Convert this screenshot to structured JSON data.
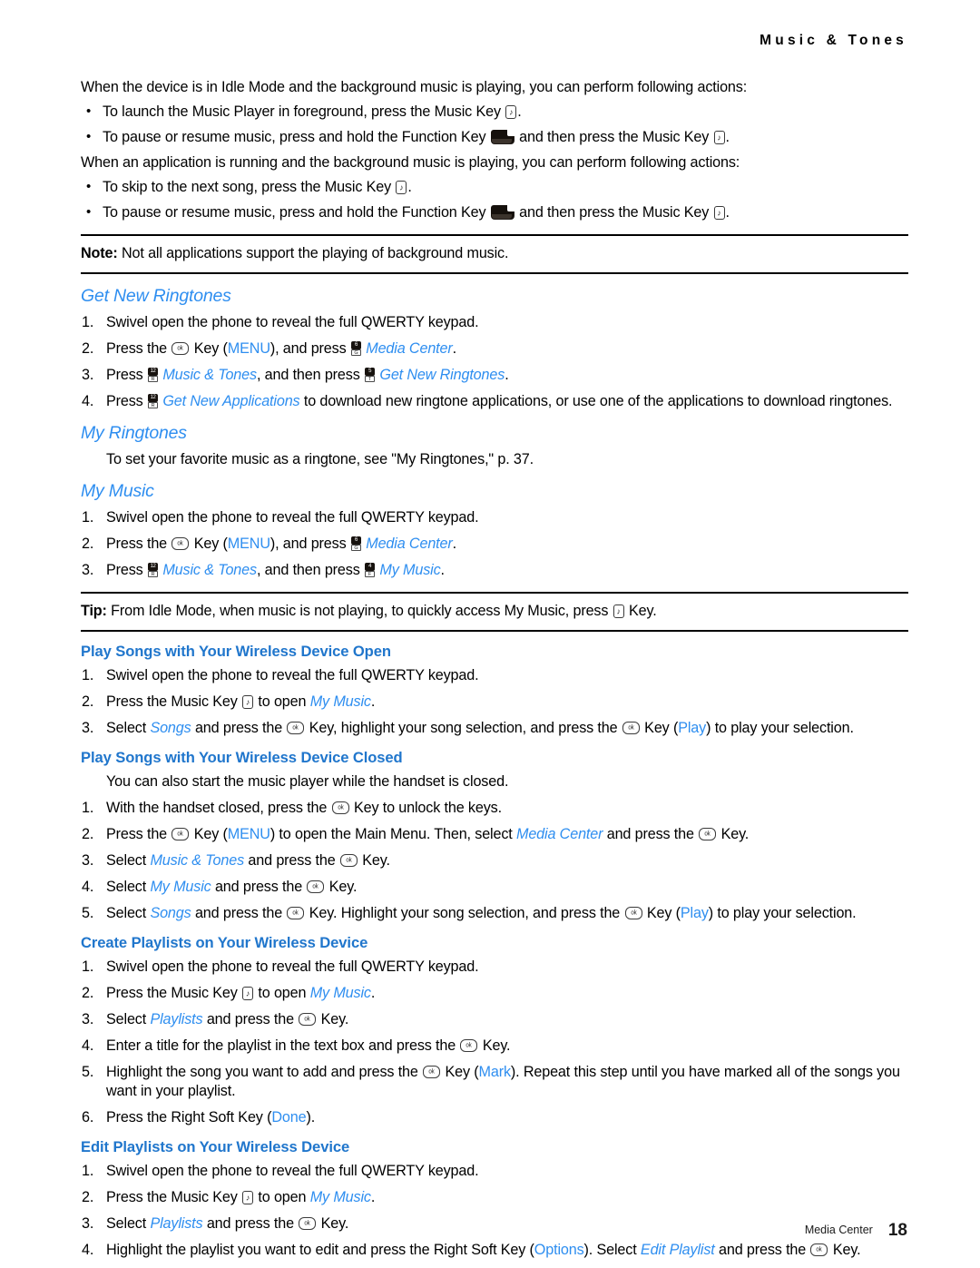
{
  "header": {
    "running_head": "Music & Tones"
  },
  "intro": {
    "para1": "When the device is in Idle Mode and the background music is playing, you can perform following actions:",
    "bullets1": [
      {
        "before": "To launch the Music Player in foreground, press the Music Key ",
        "icon": "music-key-icon",
        "after": "."
      },
      {
        "before": "To pause or resume music, press and hold the Function Key ",
        "icon": "function-key-icon",
        "mid": " and then press the Music Key ",
        "icon2": "music-key-icon",
        "after": "."
      }
    ],
    "para2": "When an application is running and the background music is playing, you can perform following actions:",
    "bullets2": [
      {
        "before": "To skip to the next song, press the Music Key ",
        "icon": "music-key-icon",
        "after": "."
      },
      {
        "before": "To pause or resume music, press and hold the Function Key ",
        "icon": "function-key-icon",
        "mid": " and then press the Music Key ",
        "icon2": "music-key-icon",
        "after": "."
      }
    ]
  },
  "note": {
    "label": "Note:",
    "text": "Not all applications support the playing of background music."
  },
  "get_new_ringtones": {
    "heading": "Get New Ringtones",
    "step1": "Swivel open the phone to reveal the full QWERTY keypad.",
    "step2": {
      "a": "Press the ",
      "b": "Key (",
      "menu": "MENU",
      "c": "), and press ",
      "link": "Media Center",
      "d": "."
    },
    "step3": {
      "a": "Press ",
      "link1": "Music & Tones",
      "b": ", and then press ",
      "link2": "Get New Ringtones",
      "c": "."
    },
    "step4": {
      "a": "Press ",
      "link": "Get New Applications",
      "b": " to download new ringtone applications, or use one of the applications to download ringtones."
    },
    "keys": {
      "step2_key": "ok-key-icon",
      "step2_letter": {
        "num": "6",
        "ltr": "G"
      },
      "step3_letter1": {
        "num": "12",
        "ltr": "R"
      },
      "step3_letter2": {
        "num": "5",
        "ltr": "T"
      },
      "step4_letter": {
        "num": "12",
        "ltr": "R"
      }
    }
  },
  "my_ringtones": {
    "heading": "My Ringtones",
    "body": "To set your favorite music as a ringtone, see \"My Ringtones,\" p. 37."
  },
  "my_music": {
    "heading": "My Music",
    "step1": "Swivel open the phone to reveal the full QWERTY keypad.",
    "step2": {
      "a": "Press the ",
      "b": "Key (",
      "menu": "MENU",
      "c": "), and press ",
      "link": "Media Center",
      "d": "."
    },
    "step3": {
      "a": "Press ",
      "link1": "Music & Tones",
      "b": ", and then press ",
      "link2": "My Music",
      "c": "."
    },
    "keys": {
      "step2_letter": {
        "num": "6",
        "ltr": "G"
      },
      "step3_letter1": {
        "num": "12",
        "ltr": "R"
      },
      "step3_letter2": {
        "num": "4",
        "ltr": "F"
      }
    }
  },
  "tip": {
    "label": "Tip:",
    "before": "From Idle Mode, when music is not playing, to quickly access My Music, press ",
    "icon": "music-key-icon",
    "after": " Key."
  },
  "play_open": {
    "heading": "Play Songs with Your Wireless Device Open",
    "step1": "Swivel open the phone to reveal the full QWERTY keypad.",
    "step2": {
      "a": "Press the Music Key ",
      "b": " to open ",
      "link": "My Music",
      "c": "."
    },
    "step3": {
      "a": "Select ",
      "it1": "Songs",
      "b": " and press the ",
      "c": " Key, highlight your song selection, and press the ",
      "d": " Key (",
      "play": "Play",
      "e": ") to play your selection."
    }
  },
  "play_closed": {
    "heading": "Play Songs with Your Wireless Device Closed",
    "intro": "You can also start the music player while the handset is closed.",
    "step1": {
      "a": "With the handset closed, press the ",
      "b": " Key to unlock the keys."
    },
    "step2": {
      "a": "Press the ",
      "b": " Key (",
      "menu": "MENU",
      "c": ") to open the Main Menu. Then, select ",
      "link": "Media Center",
      "d": " and press the ",
      "e": " Key."
    },
    "step3": {
      "a": "Select ",
      "link": "Music & Tones",
      "b": " and press the ",
      "c": " Key."
    },
    "step4": {
      "a": "Select ",
      "link": "My Music",
      "b": " and press the ",
      "c": " Key."
    },
    "step5": {
      "a": "Select ",
      "it1": "Songs",
      "b": " and press the ",
      "c": " Key. Highlight your song selection, and press the ",
      "d": " Key (",
      "play": "Play",
      "e": ") to play your selection."
    }
  },
  "create_playlists": {
    "heading": "Create Playlists on Your Wireless Device",
    "step1": "Swivel open the phone to reveal the full QWERTY keypad.",
    "step2": {
      "a": "Press the Music Key ",
      "b": " to open ",
      "link": "My Music",
      "c": "."
    },
    "step3": {
      "a": "Select ",
      "it1": "Playlists",
      "b": " and press the ",
      "c": " Key."
    },
    "step4": {
      "a": "Enter a title for the playlist in the text box and press the ",
      "b": " Key."
    },
    "step5": {
      "a": "Highlight the song you want to add and press the ",
      "b": " Key (",
      "mark": "Mark",
      "c": "). Repeat this step until you have marked all of the songs you want in your playlist."
    },
    "step6": {
      "a": "Press the Right Soft Key (",
      "done": "Done",
      "b": ")."
    }
  },
  "edit_playlists": {
    "heading": "Edit Playlists on Your Wireless Device",
    "step1": "Swivel open the phone to reveal the full QWERTY keypad.",
    "step2": {
      "a": "Press the Music Key ",
      "b": " to open ",
      "link": "My Music",
      "c": "."
    },
    "step3": {
      "a": "Select ",
      "it1": "Playlists",
      "b": " and press the ",
      "c": " Key."
    },
    "step4": {
      "a": "Highlight the playlist you want to edit and press the Right Soft Key (",
      "options": "Options",
      "b": "). Select ",
      "it1": "Edit Playlist",
      "c": " and press the ",
      "d": " Key."
    }
  },
  "footer": {
    "section": "Media Center",
    "page": "18"
  },
  "colors": {
    "heading_blue": "#2e8ef0",
    "subheading_blue": "#2076cc",
    "text_black": "#000000"
  }
}
